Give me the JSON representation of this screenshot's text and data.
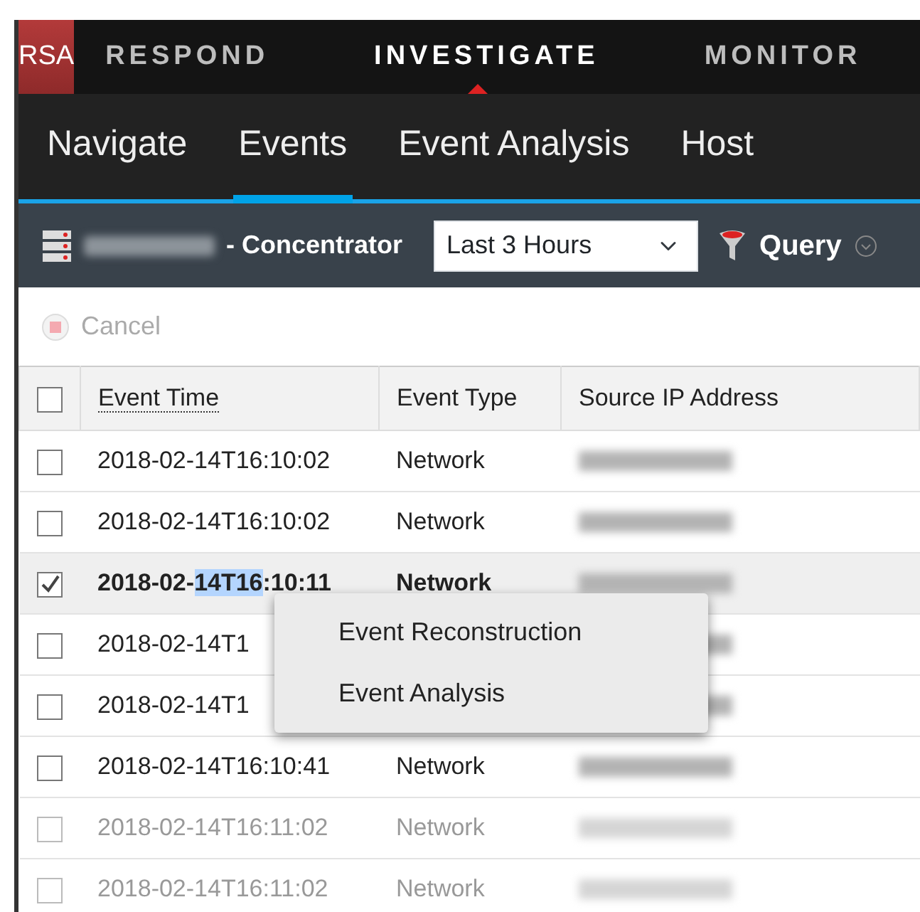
{
  "top_nav": {
    "logo": "RSA",
    "items": [
      {
        "label": "RESPOND",
        "selected": false
      },
      {
        "label": "INVESTIGATE",
        "selected": true
      },
      {
        "label": "MONITOR",
        "selected": false
      }
    ]
  },
  "sub_nav": [
    {
      "label": "Navigate",
      "selected": false
    },
    {
      "label": "Events",
      "selected": true
    },
    {
      "label": "Event Analysis",
      "selected": false
    },
    {
      "label": "Host",
      "selected": false
    }
  ],
  "toolbar": {
    "service": "- Concentrator",
    "time_range": "Last 3 Hours",
    "query": "Query"
  },
  "cancel": {
    "label": "Cancel",
    "disabled": true
  },
  "table": {
    "select_all_checked": false,
    "columns": [
      "Event Time",
      "Event Type",
      "Source IP Address"
    ],
    "rows": [
      {
        "checked": false,
        "dimmed": false,
        "time": [
          {
            "text": "2018-02-14T16:10:02",
            "selected": false
          }
        ],
        "type": "Network"
      },
      {
        "checked": false,
        "dimmed": false,
        "time": [
          {
            "text": "2018-02-14T16:10:02",
            "selected": false
          }
        ],
        "type": "Network"
      },
      {
        "checked": true,
        "dimmed": false,
        "time": [
          {
            "text": "2018-02-",
            "selected": false
          },
          {
            "text": "14T16",
            "selected": true
          },
          {
            "text": ":10:11",
            "selected": false
          }
        ],
        "type": "Network"
      },
      {
        "checked": false,
        "dimmed": false,
        "time": [
          {
            "text": "2018-02-14T1",
            "selected": false
          }
        ]
      },
      {
        "checked": false,
        "dimmed": false,
        "time": [
          {
            "text": "2018-02-14T1",
            "selected": false
          }
        ]
      },
      {
        "checked": false,
        "dimmed": false,
        "time": [
          {
            "text": "2018-02-14T16:10:41",
            "selected": false
          }
        ],
        "type": "Network"
      },
      {
        "checked": false,
        "dimmed": true,
        "time": [
          {
            "text": "2018-02-14T16:11:02",
            "selected": false
          }
        ],
        "type": "Network"
      },
      {
        "checked": false,
        "dimmed": true,
        "time": [
          {
            "text": "2018-02-14T16:11:02",
            "selected": false
          }
        ],
        "type": "Network"
      }
    ]
  },
  "context_menu": [
    "Event Reconstruction",
    "Event Analysis"
  ]
}
